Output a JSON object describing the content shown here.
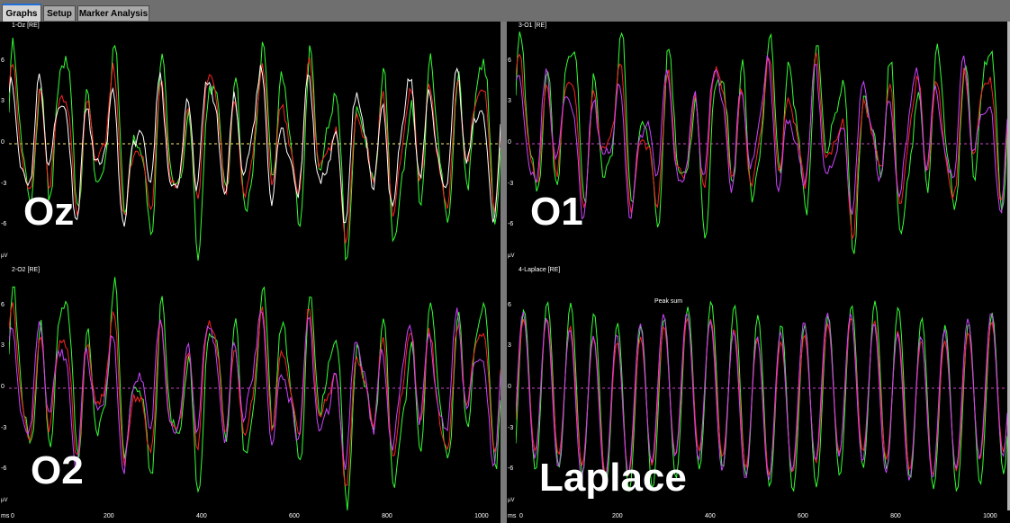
{
  "tabs": [
    {
      "label": "Graphs",
      "active": true
    },
    {
      "label": "Setup",
      "active": false
    },
    {
      "label": "Marker Analysis",
      "active": false
    }
  ],
  "units": {
    "amplitude": "µV",
    "time": "ms"
  },
  "y_ticks": [
    "6",
    "3",
    "0",
    "-3",
    "-6"
  ],
  "x_ticks": [
    "0",
    "200",
    "400",
    "600",
    "800",
    "1000"
  ],
  "colors": {
    "red": "#ff2222",
    "green": "#33ff33",
    "white": "#ffffff",
    "magenta": "#cc44ff",
    "zero_line_yellow": "#ffee66",
    "zero_line_magenta": "#cc44cc"
  },
  "panels": [
    {
      "id": "oz",
      "channel_tag": "1-Oz [RE]",
      "big_label": "Oz",
      "traces": [
        "green",
        "red",
        "white"
      ],
      "zero_color": "zero_line_yellow"
    },
    {
      "id": "o1",
      "channel_tag": "3-O1 [RE]",
      "big_label": "O1",
      "traces": [
        "green",
        "red",
        "magenta"
      ],
      "zero_color": "zero_line_magenta"
    },
    {
      "id": "o2",
      "channel_tag": "2-O2 [RE]",
      "big_label": "O2",
      "traces": [
        "green",
        "red",
        "magenta"
      ],
      "zero_color": "zero_line_magenta"
    },
    {
      "id": "laplace",
      "channel_tag": "4-Laplace [RE]",
      "big_label": "Laplace",
      "traces": [
        "green",
        "red",
        "magenta"
      ],
      "zero_color": "zero_line_magenta",
      "marker": "Peak sum"
    }
  ]
}
